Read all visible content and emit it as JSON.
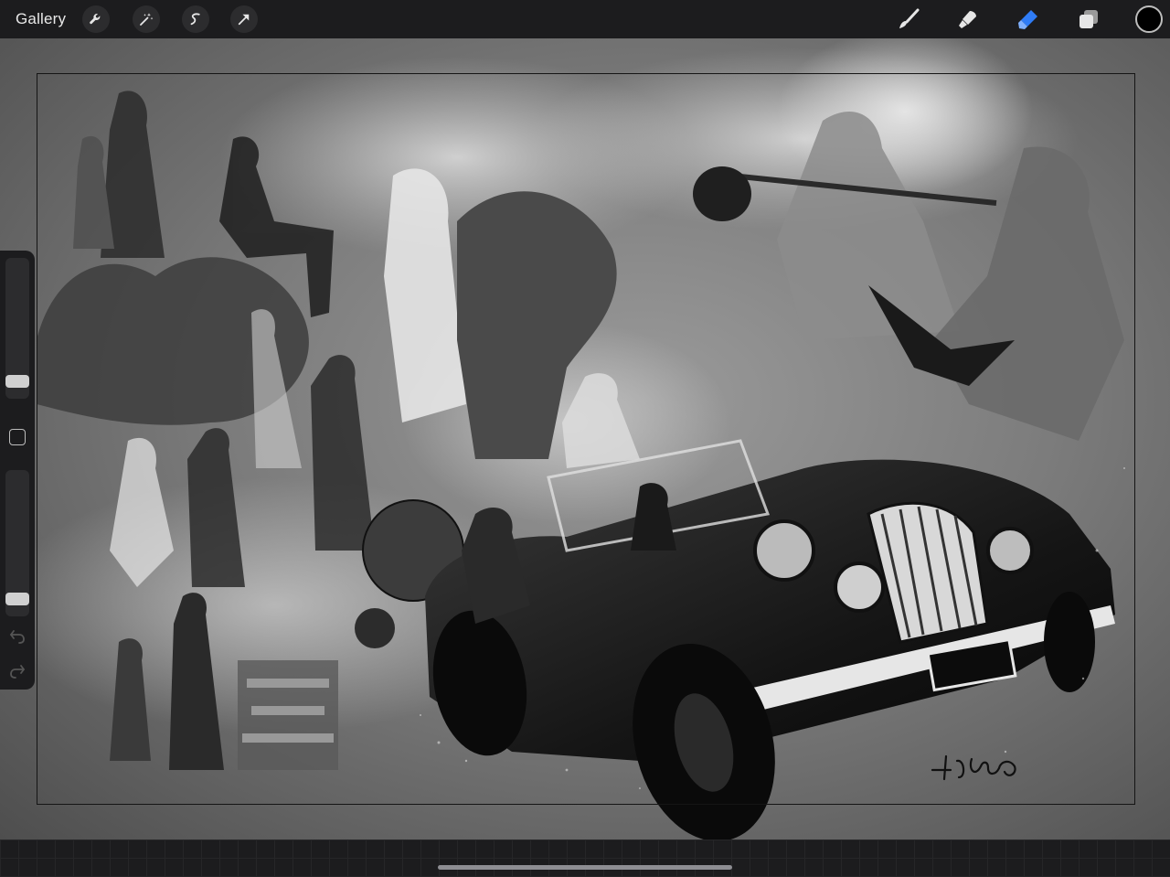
{
  "toolbar": {
    "gallery_label": "Gallery",
    "left_tools": [
      "wrench-icon",
      "magic-wand-icon",
      "selection-icon",
      "transform-arrow-icon"
    ],
    "right_tools": [
      "brush-icon",
      "smudge-icon",
      "eraser-icon",
      "layers-icon"
    ],
    "active_tool": "eraser-icon",
    "accent_color": "#2f7cf6",
    "current_color": "#000000"
  },
  "canvas": {
    "background_color": "#7c7c7c",
    "artwork_style": "grayscale illustration"
  },
  "sidebar": {
    "brush_size": 0.06,
    "brush_opacity": 0.06,
    "icons": [
      "modify-square-icon",
      "undo-icon",
      "redo-icon"
    ]
  }
}
